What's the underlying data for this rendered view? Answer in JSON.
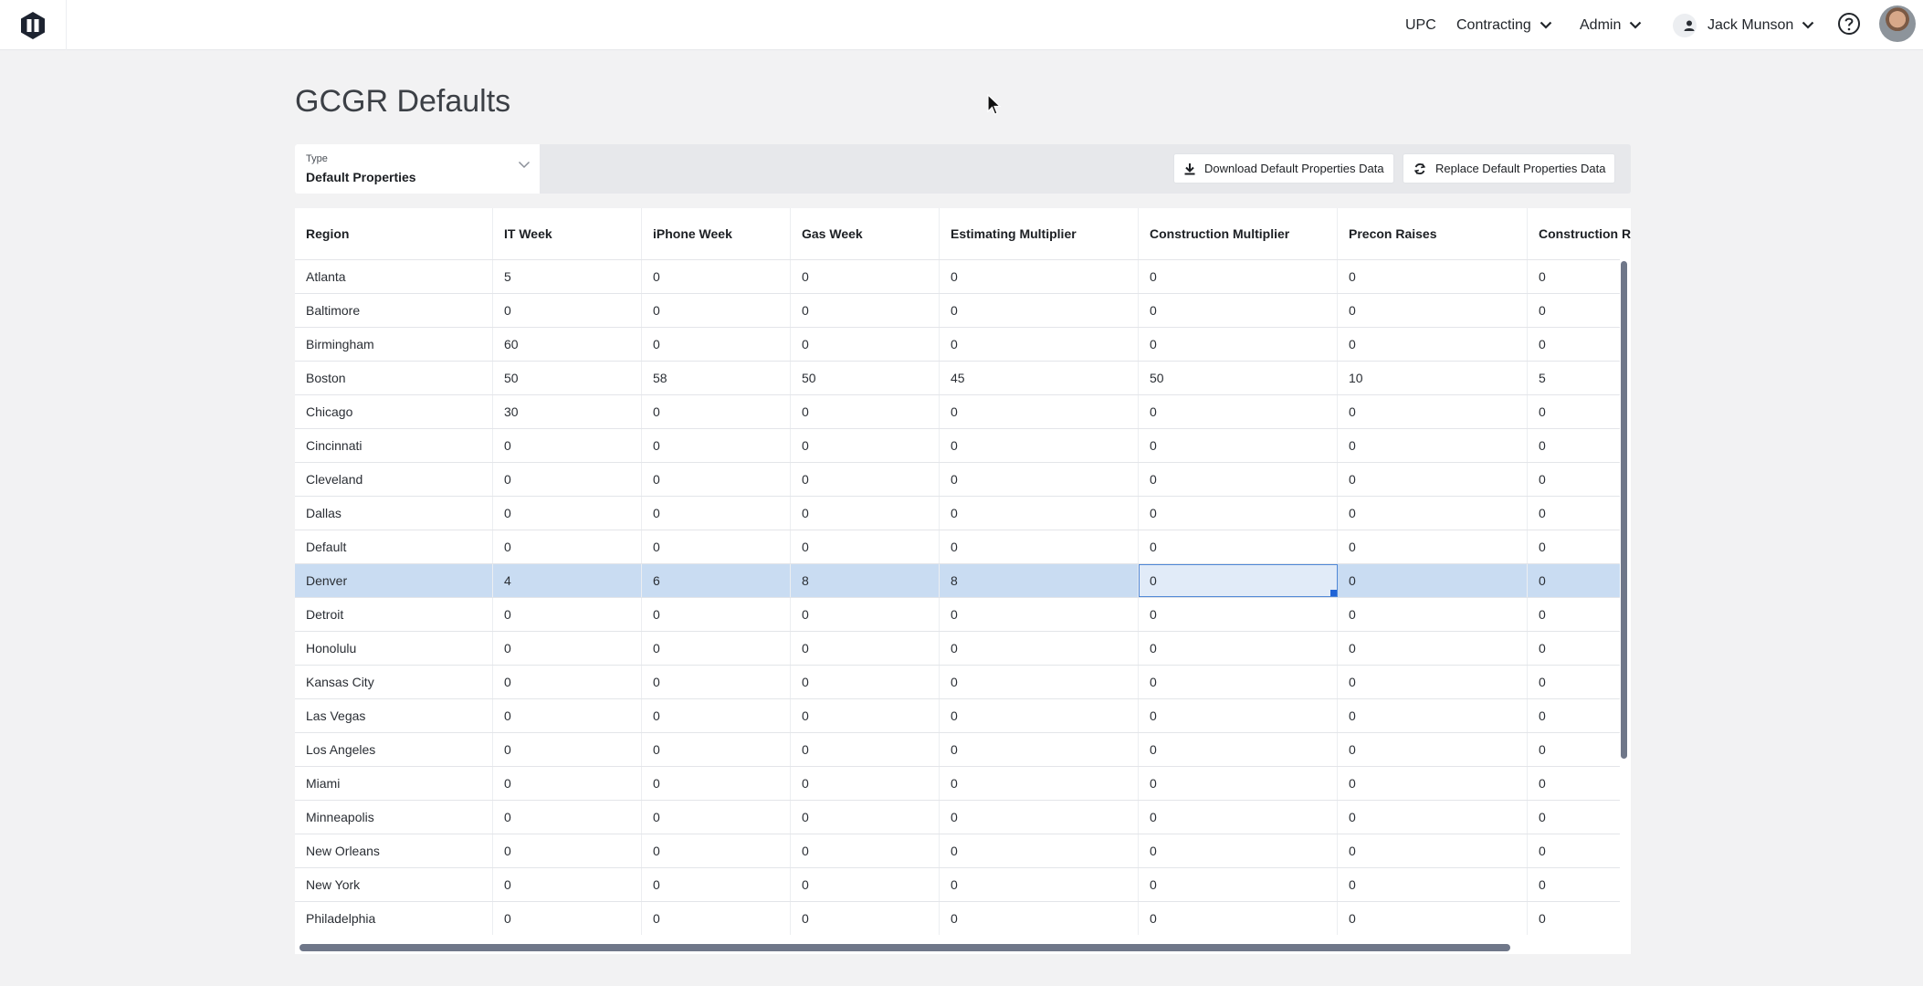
{
  "header": {
    "logo": "app-logo-icon",
    "nav": [
      {
        "label": "UPC",
        "has_menu": false
      },
      {
        "label": "Contracting",
        "has_menu": true
      },
      {
        "label": "Admin",
        "has_menu": true
      }
    ],
    "user": {
      "name": "Jack Munson",
      "icon": "person-icon"
    },
    "help_icon": "help-circle-icon"
  },
  "page": {
    "title": "GCGR Defaults"
  },
  "toolbar": {
    "type_label": "Type",
    "type_value": "Default Properties",
    "download_label": "Download Default Properties Data",
    "replace_label": "Replace Default Properties Data"
  },
  "grid": {
    "columns": [
      "Region",
      "IT Week",
      "iPhone Week",
      "Gas Week",
      "Estimating Multiplier",
      "Construction Multiplier",
      "Precon Raises",
      "Construction Raises"
    ],
    "selected_row": "Denver",
    "focused_column": "Construction Multiplier",
    "rows": [
      [
        "Atlanta",
        "5",
        "0",
        "0",
        "0",
        "0",
        "0",
        "0"
      ],
      [
        "Baltimore",
        "0",
        "0",
        "0",
        "0",
        "0",
        "0",
        "0"
      ],
      [
        "Birmingham",
        "60",
        "0",
        "0",
        "0",
        "0",
        "0",
        "0"
      ],
      [
        "Boston",
        "50",
        "58",
        "50",
        "45",
        "50",
        "10",
        "5"
      ],
      [
        "Chicago",
        "30",
        "0",
        "0",
        "0",
        "0",
        "0",
        "0"
      ],
      [
        "Cincinnati",
        "0",
        "0",
        "0",
        "0",
        "0",
        "0",
        "0"
      ],
      [
        "Cleveland",
        "0",
        "0",
        "0",
        "0",
        "0",
        "0",
        "0"
      ],
      [
        "Dallas",
        "0",
        "0",
        "0",
        "0",
        "0",
        "0",
        "0"
      ],
      [
        "Default",
        "0",
        "0",
        "0",
        "0",
        "0",
        "0",
        "0"
      ],
      [
        "Denver",
        "4",
        "6",
        "8",
        "8",
        "0",
        "0",
        "0"
      ],
      [
        "Detroit",
        "0",
        "0",
        "0",
        "0",
        "0",
        "0",
        "0"
      ],
      [
        "Honolulu",
        "0",
        "0",
        "0",
        "0",
        "0",
        "0",
        "0"
      ],
      [
        "Kansas City",
        "0",
        "0",
        "0",
        "0",
        "0",
        "0",
        "0"
      ],
      [
        "Las Vegas",
        "0",
        "0",
        "0",
        "0",
        "0",
        "0",
        "0"
      ],
      [
        "Los Angeles",
        "0",
        "0",
        "0",
        "0",
        "0",
        "0",
        "0"
      ],
      [
        "Miami",
        "0",
        "0",
        "0",
        "0",
        "0",
        "0",
        "0"
      ],
      [
        "Minneapolis",
        "0",
        "0",
        "0",
        "0",
        "0",
        "0",
        "0"
      ],
      [
        "New Orleans",
        "0",
        "0",
        "0",
        "0",
        "0",
        "0",
        "0"
      ],
      [
        "New York",
        "0",
        "0",
        "0",
        "0",
        "0",
        "0",
        "0"
      ],
      [
        "Philadelphia",
        "0",
        "0",
        "0",
        "0",
        "0",
        "0",
        "0"
      ]
    ]
  }
}
